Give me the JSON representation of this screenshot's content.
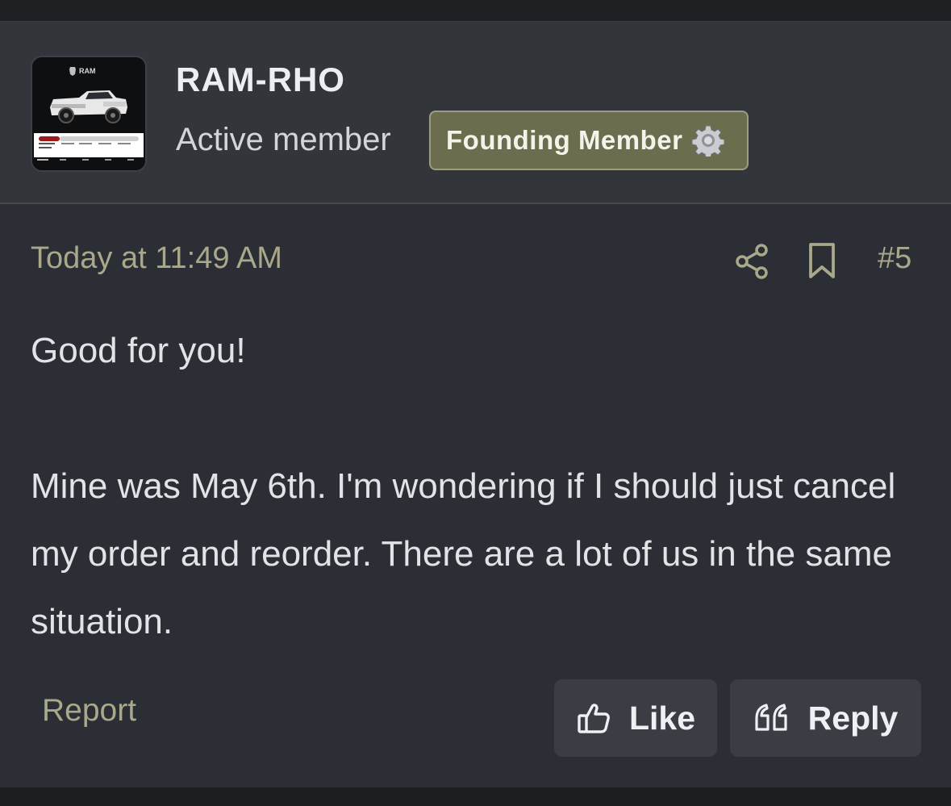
{
  "author": {
    "username": "RAM-RHO",
    "user_title": "Active member",
    "badge": {
      "label": "Founding Member",
      "icon": "gear-icon",
      "color": "#6b6d4e"
    },
    "avatar": {
      "icon": "truck-order-tracker-image",
      "logo_text": "RAM"
    }
  },
  "post": {
    "timestamp": "Today at 11:49 AM",
    "number": "#5",
    "paragraphs": [
      "Good for you!",
      "Mine was May 6th. I'm wondering if I should just cancel my order and reorder. There are a lot of us in the same situation."
    ]
  },
  "actions": {
    "share_icon": "share-icon",
    "bookmark_icon": "bookmark-icon",
    "report_label": "Report",
    "like_label": "Like",
    "like_icon": "thumbs-up-icon",
    "reply_label": "Reply",
    "reply_icon": "quote-icon"
  },
  "colors": {
    "accent_muted": "#a9a88b",
    "header_bg": "#32353a",
    "body_bg": "#2b2e34",
    "button_bg": "#3a3d43"
  }
}
